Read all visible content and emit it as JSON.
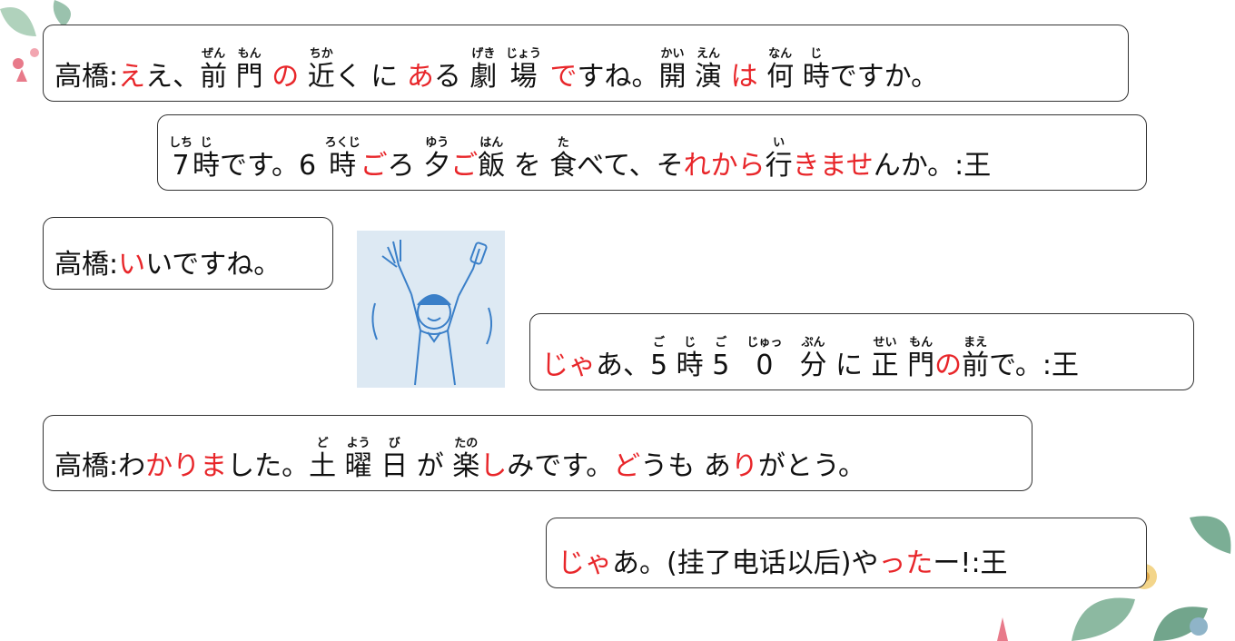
{
  "colors": {
    "accent_red": "#e8262a",
    "text": "#111111",
    "border": "#333333",
    "illustration_bg": "#dde9f3"
  },
  "icons": [
    "floral-decoration-icon",
    "person-cheering-illustration"
  ],
  "lines": [
    {
      "id": "line-1",
      "segments": [
        {
          "t": "高橋:",
          "r": "",
          "c": "k"
        },
        {
          "t": "え",
          "r": "",
          "c": "r"
        },
        {
          "t": "え、",
          "r": "",
          "c": "k"
        },
        {
          "t": "前",
          "r": "ぜん",
          "c": "k"
        },
        {
          "t": " ",
          "r": "",
          "c": "k"
        },
        {
          "t": "門",
          "r": "もん",
          "c": "k"
        },
        {
          "t": " ",
          "r": "",
          "c": "k"
        },
        {
          "t": "の",
          "r": "",
          "c": "r"
        },
        {
          "t": " ",
          "r": "",
          "c": "k"
        },
        {
          "t": "近",
          "r": "ちか",
          "c": "k"
        },
        {
          "t": "く ",
          "r": "",
          "c": "k"
        },
        {
          "t": "に ",
          "r": "",
          "c": "k"
        },
        {
          "t": "あ",
          "r": "",
          "c": "r"
        },
        {
          "t": "る ",
          "r": "",
          "c": "k"
        },
        {
          "t": "劇",
          "r": "げき",
          "c": "k"
        },
        {
          "t": " ",
          "r": "",
          "c": "k"
        },
        {
          "t": "場",
          "r": "じょう",
          "c": "k"
        },
        {
          "t": " ",
          "r": "",
          "c": "k"
        },
        {
          "t": "で",
          "r": "",
          "c": "r"
        },
        {
          "t": "すね。",
          "r": "",
          "c": "k"
        },
        {
          "t": "開",
          "r": "かい",
          "c": "k"
        },
        {
          "t": " ",
          "r": "",
          "c": "k"
        },
        {
          "t": "演",
          "r": "えん",
          "c": "k"
        },
        {
          "t": " ",
          "r": "",
          "c": "k"
        },
        {
          "t": "は",
          "r": "",
          "c": "r"
        },
        {
          "t": " ",
          "r": "",
          "c": "k"
        },
        {
          "t": "何",
          "r": "なん",
          "c": "k"
        },
        {
          "t": " ",
          "r": "",
          "c": "k"
        },
        {
          "t": "時",
          "r": "じ",
          "c": "k"
        },
        {
          "t": "ですか。",
          "r": "",
          "c": "k"
        }
      ]
    },
    {
      "id": "line-2",
      "segments": [
        {
          "t": "7",
          "r": "しち",
          "c": "k"
        },
        {
          "t": "時",
          "r": "じ",
          "c": "k"
        },
        {
          "t": "です。6 ",
          "r": "",
          "c": "k"
        },
        {
          "t": "時",
          "r": "ろくじ",
          "c": "k"
        },
        {
          "t": "ご",
          "r": "",
          "c": "r"
        },
        {
          "t": "ろ ",
          "r": "",
          "c": "k"
        },
        {
          "t": "夕",
          "r": "ゆう",
          "c": "k"
        },
        {
          "t": "ご",
          "r": "",
          "c": "r"
        },
        {
          "t": "飯",
          "r": "はん",
          "c": "k"
        },
        {
          "t": " を ",
          "r": "",
          "c": "k"
        },
        {
          "t": "食",
          "r": "た",
          "c": "k"
        },
        {
          "t": "べて、そ",
          "r": "",
          "c": "k"
        },
        {
          "t": "れから",
          "r": "",
          "c": "r"
        },
        {
          "t": "行",
          "r": "い",
          "c": "k"
        },
        {
          "t": "きませ",
          "r": "",
          "c": "r"
        },
        {
          "t": "んか。:王",
          "r": "",
          "c": "k"
        }
      ]
    },
    {
      "id": "line-3",
      "segments": [
        {
          "t": "高橋:",
          "r": "",
          "c": "k"
        },
        {
          "t": "い",
          "r": "",
          "c": "r"
        },
        {
          "t": "いですね。",
          "r": "",
          "c": "k"
        }
      ]
    },
    {
      "id": "line-4",
      "segments": [
        {
          "t": "じゃ",
          "r": "",
          "c": "r"
        },
        {
          "t": "あ、",
          "r": "",
          "c": "k"
        },
        {
          "t": "5",
          "r": "ご",
          "c": "k"
        },
        {
          "t": " ",
          "r": "",
          "c": "k"
        },
        {
          "t": "時",
          "r": "じ",
          "c": "k"
        },
        {
          "t": " ",
          "r": "",
          "c": "k"
        },
        {
          "t": "5",
          "r": "ご",
          "c": "k"
        },
        {
          "t": "  ",
          "r": "",
          "c": "k"
        },
        {
          "t": "0",
          "r": "じゅっ",
          "c": "k"
        },
        {
          "t": "  ",
          "r": "",
          "c": "k"
        },
        {
          "t": "分",
          "r": "ぷん",
          "c": "k"
        },
        {
          "t": " に ",
          "r": "",
          "c": "k"
        },
        {
          "t": "正",
          "r": "せい",
          "c": "k"
        },
        {
          "t": " ",
          "r": "",
          "c": "k"
        },
        {
          "t": "門",
          "r": "もん",
          "c": "k"
        },
        {
          "t": "の",
          "r": "",
          "c": "r"
        },
        {
          "t": "前",
          "r": "まえ",
          "c": "k"
        },
        {
          "t": "で。:王",
          "r": "",
          "c": "k"
        }
      ]
    },
    {
      "id": "line-5",
      "segments": [
        {
          "t": "高橋:わ",
          "r": "",
          "c": "k"
        },
        {
          "t": "かりま",
          "r": "",
          "c": "r"
        },
        {
          "t": "した。",
          "r": "",
          "c": "k"
        },
        {
          "t": "土",
          "r": "ど",
          "c": "k"
        },
        {
          "t": " ",
          "r": "",
          "c": "k"
        },
        {
          "t": "曜",
          "r": "よう",
          "c": "k"
        },
        {
          "t": " ",
          "r": "",
          "c": "k"
        },
        {
          "t": "日",
          "r": "び",
          "c": "k"
        },
        {
          "t": " が ",
          "r": "",
          "c": "k"
        },
        {
          "t": "楽",
          "r": "たの",
          "c": "k"
        },
        {
          "t": "し",
          "r": "",
          "c": "r"
        },
        {
          "t": "みです。",
          "r": "",
          "c": "k"
        },
        {
          "t": "ど",
          "r": "",
          "c": "r"
        },
        {
          "t": "うも あ",
          "r": "",
          "c": "k"
        },
        {
          "t": "り",
          "r": "",
          "c": "r"
        },
        {
          "t": "がとう。",
          "r": "",
          "c": "k"
        }
      ]
    },
    {
      "id": "line-6",
      "segments": [
        {
          "t": "じゃ",
          "r": "",
          "c": "r"
        },
        {
          "t": "あ。(挂了电话以后)や",
          "r": "",
          "c": "k"
        },
        {
          "t": "った",
          "r": "",
          "c": "r"
        },
        {
          "t": "ー!:王",
          "r": "",
          "c": "k"
        }
      ]
    }
  ]
}
